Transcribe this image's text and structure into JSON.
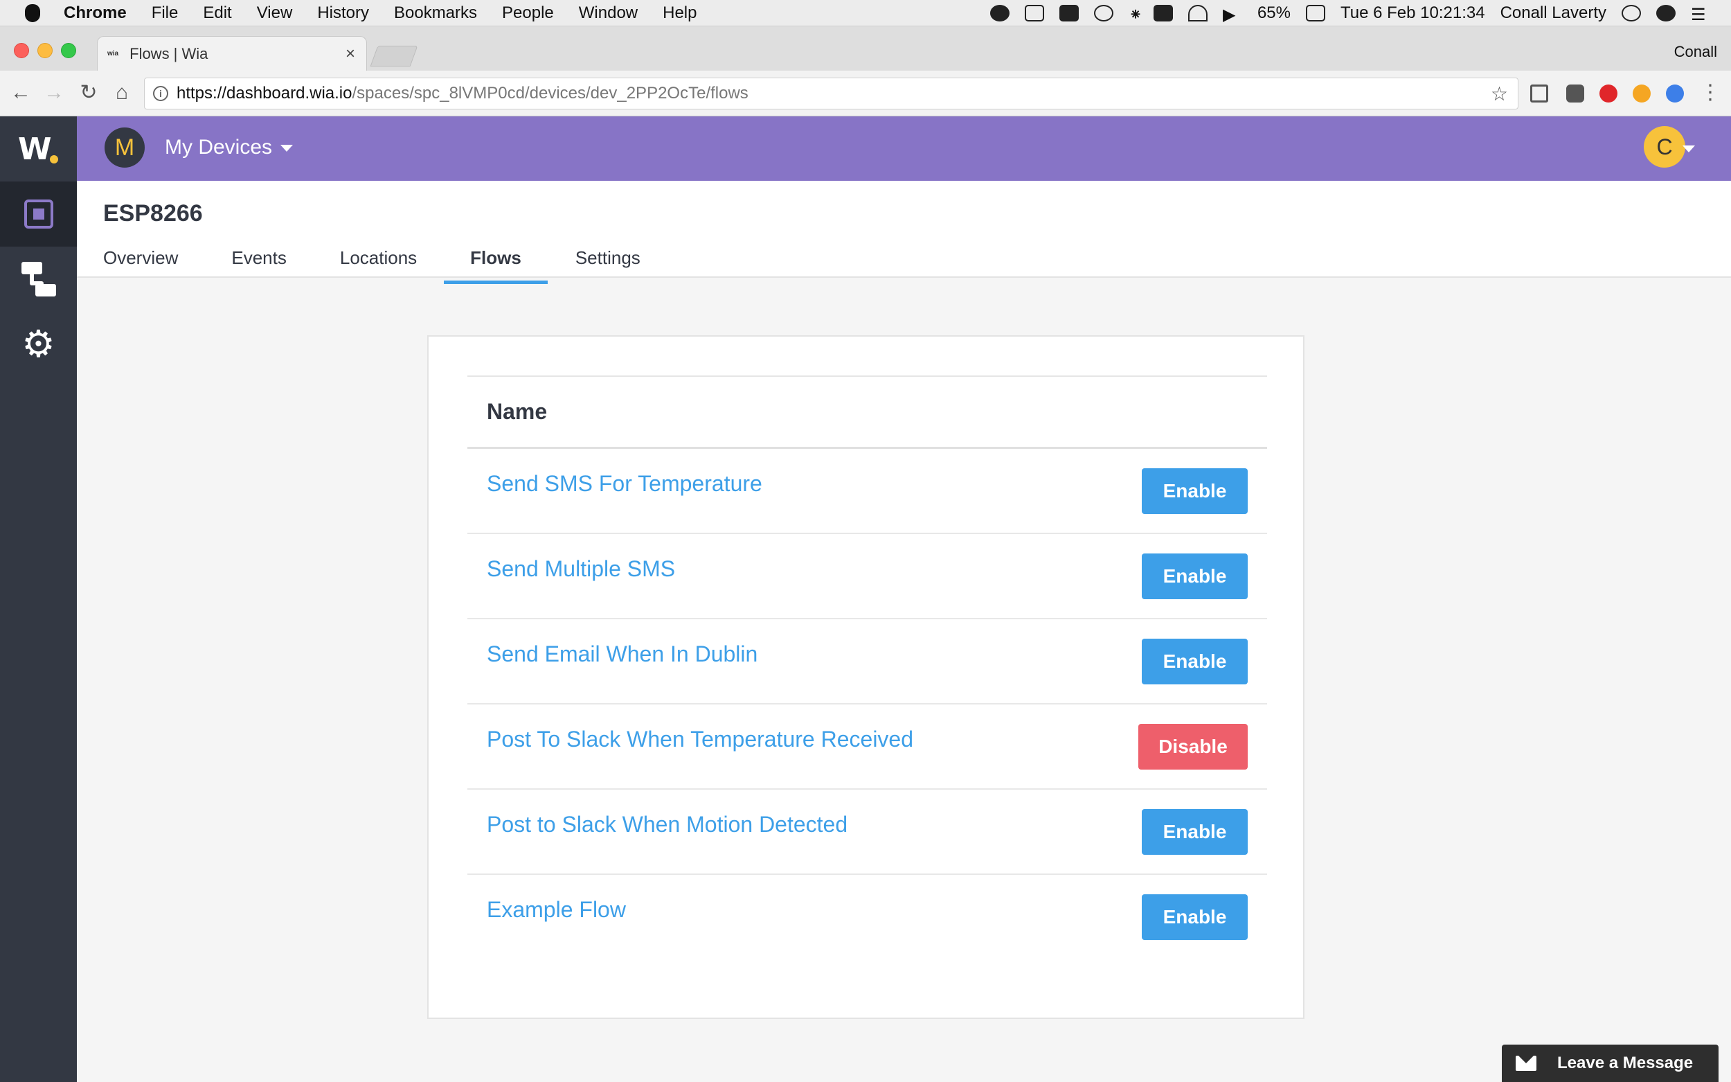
{
  "menubar": {
    "app_name": "Chrome",
    "items": [
      "File",
      "Edit",
      "View",
      "History",
      "Bookmarks",
      "People",
      "Window",
      "Help"
    ],
    "battery": "65%",
    "datetime": "Tue 6 Feb  10:21:34",
    "user": "Conall Laverty"
  },
  "browser": {
    "tab_title": "Flows | Wia",
    "tab_favicon": "wia",
    "profile": "Conall",
    "url_host": "https://dashboard.wia.io",
    "url_path": "/spaces/spc_8lVMP0cd/devices/dev_2PP2OcTe/flows"
  },
  "app": {
    "space_initial": "M",
    "space_name": "My Devices",
    "user_initial": "C",
    "logo": "W"
  },
  "device": {
    "name": "ESP8266",
    "tabs": [
      {
        "label": "Overview"
      },
      {
        "label": "Events"
      },
      {
        "label": "Locations"
      },
      {
        "label": "Flows"
      },
      {
        "label": "Settings"
      }
    ],
    "active_tab": "Flows"
  },
  "flows": {
    "column_header": "Name",
    "rows": [
      {
        "name": "Send SMS For Temperature",
        "action": "Enable"
      },
      {
        "name": "Send Multiple SMS",
        "action": "Enable"
      },
      {
        "name": "Send Email When In Dublin",
        "action": "Enable"
      },
      {
        "name": "Post To Slack When Temperature Received",
        "action": "Disable"
      },
      {
        "name": "Post to Slack When Motion Detected",
        "action": "Enable"
      },
      {
        "name": "Example Flow",
        "action": "Enable"
      }
    ]
  },
  "widget": {
    "label": "Leave a Message"
  },
  "colors": {
    "header_purple": "#8774c6",
    "sidebar": "#333843",
    "link_blue": "#3d9fe8",
    "disable_red": "#ee5f6b",
    "avatar_yellow": "#f7c23b"
  }
}
